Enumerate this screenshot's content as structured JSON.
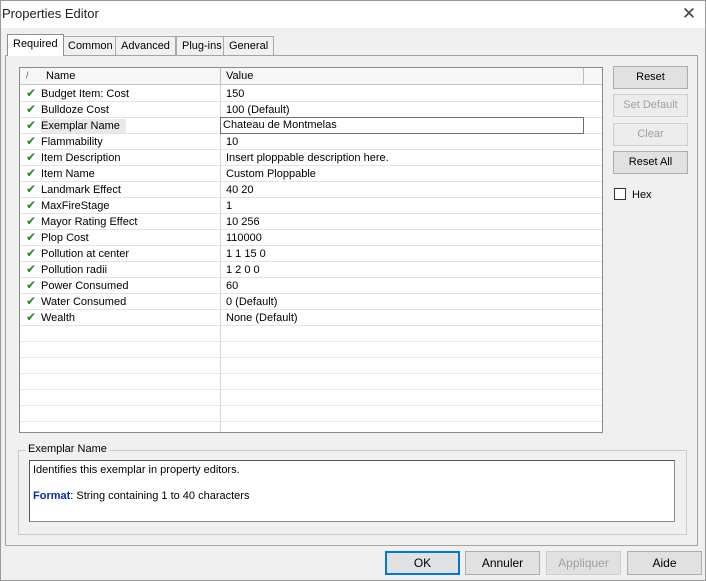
{
  "window": {
    "title": "Properties Editor",
    "close_glyph": "✕"
  },
  "tabs": [
    {
      "label": "Required",
      "active": true
    },
    {
      "label": "Common",
      "active": false
    },
    {
      "label": "Advanced",
      "active": false
    },
    {
      "label": "Plug-ins",
      "active": false
    },
    {
      "label": "General",
      "active": false
    }
  ],
  "grid": {
    "sort_glyph": "/",
    "columns": {
      "name": "Name",
      "value": "Value"
    },
    "check_glyph": "✔",
    "rows": [
      {
        "name": "Budget Item: Cost",
        "value": "150"
      },
      {
        "name": "Bulldoze Cost",
        "value": "100   (Default)"
      },
      {
        "name": "Exemplar Name",
        "value": "Chateau de Montmelas",
        "editing": true
      },
      {
        "name": "Flammability",
        "value": "10"
      },
      {
        "name": "Item Description",
        "value": "Insert ploppable description here."
      },
      {
        "name": "Item Name",
        "value": "Custom Ploppable"
      },
      {
        "name": "Landmark Effect",
        "value": "40 20"
      },
      {
        "name": "MaxFireStage",
        "value": "1"
      },
      {
        "name": "Mayor Rating Effect",
        "value": "10 256"
      },
      {
        "name": "Plop Cost",
        "value": "110000"
      },
      {
        "name": "Pollution at center",
        "value": "1 1 15 0"
      },
      {
        "name": "Pollution radii",
        "value": "1 2 0 0"
      },
      {
        "name": "Power Consumed",
        "value": "60"
      },
      {
        "name": "Water Consumed",
        "value": "0   (Default)"
      },
      {
        "name": "Wealth",
        "value": "None   (Default)"
      }
    ]
  },
  "side_buttons": {
    "reset": "Reset",
    "set_default": "Set Default",
    "clear": "Clear",
    "reset_all": "Reset All"
  },
  "hex_label": "Hex",
  "description": {
    "group_label": "Exemplar Name",
    "text": "Identifies this exemplar in property editors.",
    "format_label": "Format",
    "format_value": ": String containing 1 to 40 characters"
  },
  "bottom_buttons": {
    "ok": "OK",
    "cancel": "Annuler",
    "apply": "Appliquer",
    "help": "Aide"
  }
}
